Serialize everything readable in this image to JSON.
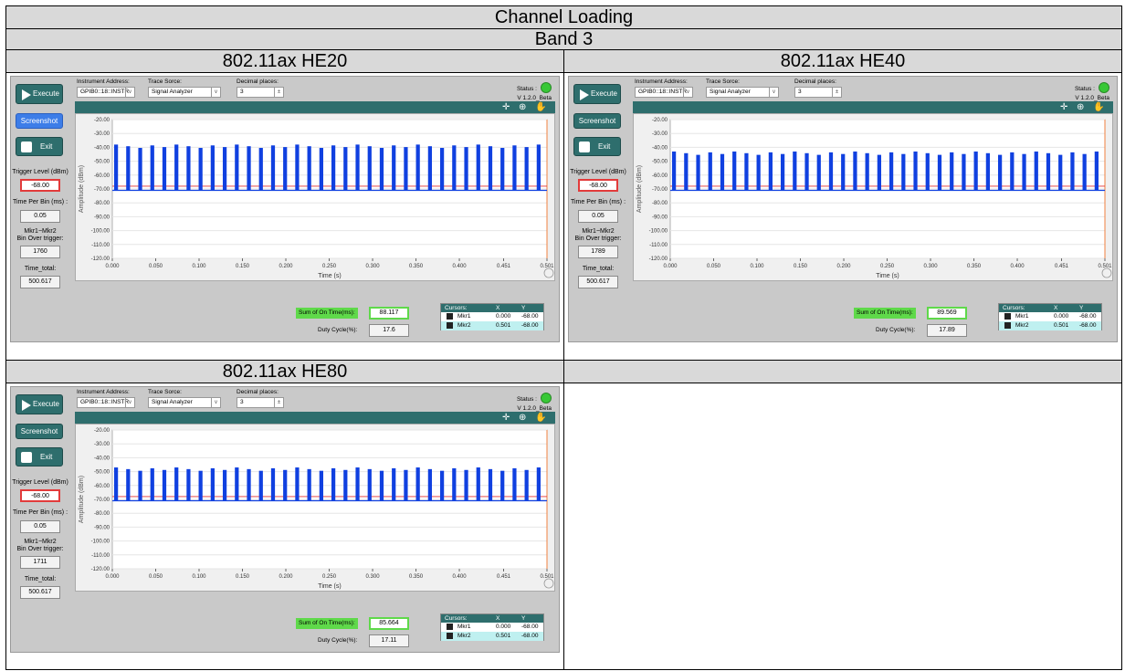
{
  "title": "Channel Loading",
  "band": "Band 3",
  "panels": [
    {
      "heading": "802.11ax HE20",
      "screenshot_active": true,
      "execute_label": "Execute",
      "screenshot_label": "Screenshot",
      "exit_label": "Exit",
      "instrument_address_label": "Instrument Address:",
      "instrument_address_value": "GPIB0::18::INSTR",
      "trace_source_label": "Trace Sorce:",
      "trace_source_value": "Signal Analyzer",
      "decimal_places_label": "Decimal places:",
      "decimal_places_value": "3",
      "status_label": "Status :",
      "version": "V 1.2.0_Beta",
      "trigger_level_label": "Trigger Level (dBm)",
      "trigger_level_value": "-68.00",
      "time_per_bin_label": "Time Per Bin (ms) :",
      "time_per_bin_value": "0.05",
      "mkr_label_1": "Mkr1~Mkr2",
      "mkr_label_2": "Bin Over trigger:",
      "mkr_value": "1760",
      "time_total_label": "Time_total:",
      "time_total_value": "500.617",
      "sum_label": "Sum of On Time(ms):",
      "sum_value": "88.117",
      "duty_label": "Duty Cycle(%):",
      "duty_value": "17.6",
      "cursors_header": {
        "name": "Cursors:",
        "x": "X",
        "y": "Y"
      },
      "cursors": [
        {
          "name": "Mkr1",
          "x": "0.000",
          "y": "-68.00"
        },
        {
          "name": "Mkr2",
          "x": "0.501",
          "y": "-68.00"
        }
      ],
      "chart_data": {
        "type": "line",
        "xlabel": "Time (s)",
        "ylabel": "Amplitude (dBm)",
        "xlim": [
          0,
          0.501
        ],
        "ylim": [
          -120,
          -20
        ],
        "x_ticks": [
          "0.000",
          "0.050",
          "0.100",
          "0.150",
          "0.200",
          "0.250",
          "0.300",
          "0.350",
          "0.400",
          "0.451",
          "0.501"
        ],
        "y_ticks": [
          "-20.00",
          "-30.00",
          "-40.00",
          "-50.00",
          "-60.00",
          "-70.00",
          "-80.00",
          "-90.00",
          "-100.00",
          "-110.00",
          "-120.00"
        ],
        "baseline_dbm": -71,
        "burst_peak_dbm": -38,
        "burst_count": 36,
        "trigger_level_dbm": -68,
        "color": "#1040e0"
      }
    },
    {
      "heading": "802.11ax HE40",
      "screenshot_active": false,
      "execute_label": "Execute",
      "screenshot_label": "Screenshot",
      "exit_label": "Exit",
      "instrument_address_label": "Instrument Address:",
      "instrument_address_value": "GPIB0::18::INSTR",
      "trace_source_label": "Trace Sorce:",
      "trace_source_value": "Signal Analyzer",
      "decimal_places_label": "Decimal places:",
      "decimal_places_value": "3",
      "status_label": "Status :",
      "version": "V 1.2.0_Beta",
      "trigger_level_label": "Trigger Level (dBm)",
      "trigger_level_value": "-68.00",
      "time_per_bin_label": "Time Per Bin (ms) :",
      "time_per_bin_value": "0.05",
      "mkr_label_1": "Mkr1~Mkr2",
      "mkr_label_2": "Bin Over trigger:",
      "mkr_value": "1789",
      "time_total_label": "Time_total:",
      "time_total_value": "500.617",
      "sum_label": "Sum of On Time(ms):",
      "sum_value": "89.569",
      "duty_label": "Duty Cycle(%):",
      "duty_value": "17.89",
      "cursors_header": {
        "name": "Cursors:",
        "x": "X",
        "y": "Y"
      },
      "cursors": [
        {
          "name": "Mkr1",
          "x": "0.000",
          "y": "-68.00"
        },
        {
          "name": "Mkr2",
          "x": "0.501",
          "y": "-68.00"
        }
      ],
      "chart_data": {
        "type": "line",
        "xlabel": "Time (s)",
        "ylabel": "Amplitude (dBm)",
        "xlim": [
          0,
          0.501
        ],
        "ylim": [
          -120,
          -20
        ],
        "x_ticks": [
          "0.000",
          "0.050",
          "0.100",
          "0.150",
          "0.200",
          "0.250",
          "0.300",
          "0.350",
          "0.400",
          "0.451",
          "0.501"
        ],
        "y_ticks": [
          "-20.00",
          "-30.00",
          "-40.00",
          "-50.00",
          "-60.00",
          "-70.00",
          "-80.00",
          "-90.00",
          "-100.00",
          "-110.00",
          "-120.00"
        ],
        "baseline_dbm": -71,
        "burst_peak_dbm": -43,
        "burst_count": 36,
        "trigger_level_dbm": -68,
        "color": "#1040e0"
      }
    },
    {
      "heading": "802.11ax HE80",
      "screenshot_active": false,
      "execute_label": "Execute",
      "screenshot_label": "Screenshot",
      "exit_label": "Exit",
      "instrument_address_label": "Instrument Address:",
      "instrument_address_value": "GPIB0::18::INSTR",
      "trace_source_label": "Trace Sorce:",
      "trace_source_value": "Signal Analyzer",
      "decimal_places_label": "Decimal places:",
      "decimal_places_value": "3",
      "status_label": "Status :",
      "version": "V 1.2.0_Beta",
      "trigger_level_label": "Trigger Level (dBm)",
      "trigger_level_value": "-68.00",
      "time_per_bin_label": "Time Per Bin (ms) :",
      "time_per_bin_value": "0.05",
      "mkr_label_1": "Mkr1~Mkr2",
      "mkr_label_2": "Bin Over trigger:",
      "mkr_value": "1711",
      "time_total_label": "Time_total:",
      "time_total_value": "500.617",
      "sum_label": "Sum of On Time(ms):",
      "sum_value": "85.664",
      "duty_label": "Duty Cycle(%):",
      "duty_value": "17.11",
      "cursors_header": {
        "name": "Cursors:",
        "x": "X",
        "y": "Y"
      },
      "cursors": [
        {
          "name": "Mkr1",
          "x": "0.000",
          "y": "-68.00"
        },
        {
          "name": "Mkr2",
          "x": "0.501",
          "y": "-68.00"
        }
      ],
      "chart_data": {
        "type": "line",
        "xlabel": "Time (s)",
        "ylabel": "Amplitude (dBm)",
        "xlim": [
          0,
          0.501
        ],
        "ylim": [
          -120,
          -20
        ],
        "x_ticks": [
          "0.000",
          "0.050",
          "0.100",
          "0.150",
          "0.200",
          "0.250",
          "0.300",
          "0.350",
          "0.400",
          "0.451",
          "0.501"
        ],
        "y_ticks": [
          "-20.00",
          "-30.00",
          "-40.00",
          "-50.00",
          "-60.00",
          "-70.00",
          "-80.00",
          "-90.00",
          "-100.00",
          "-110.00",
          "-120.00"
        ],
        "baseline_dbm": -71,
        "burst_peak_dbm": -47,
        "burst_count": 36,
        "trigger_level_dbm": -68,
        "color": "#1040e0"
      }
    }
  ]
}
